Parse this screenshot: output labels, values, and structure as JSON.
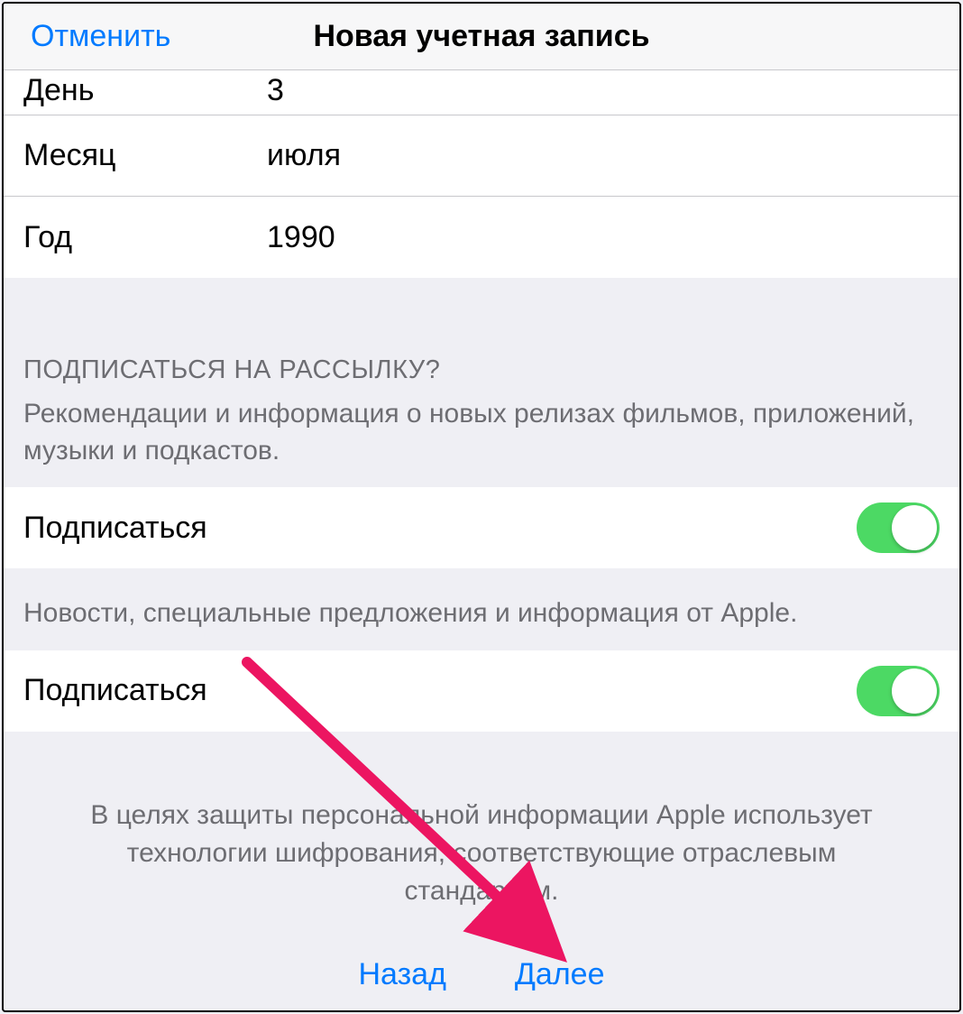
{
  "navbar": {
    "cancel": "Отменить",
    "title": "Новая учетная запись"
  },
  "date_rows": {
    "day_label": "День",
    "day_value": "3",
    "month_label": "Месяц",
    "month_value": "июля",
    "year_label": "Год",
    "year_value": "1990"
  },
  "subscribe_section": {
    "header": "ПОДПИСАТЬСЯ НА РАССЫЛКУ?",
    "desc1": "Рекомендации и информация о новых релизах фильмов, приложений, музыки и подкастов.",
    "toggle1_label": "Подписаться",
    "toggle1_on": true,
    "desc2": "Новости, специальные предложения и информация от Apple.",
    "toggle2_label": "Подписаться",
    "toggle2_on": true
  },
  "footer": {
    "privacy": "В целях защиты персональной информации Apple использует технологии шифрования, соответствующие отраслевым стандартам."
  },
  "bottom_nav": {
    "back": "Назад",
    "next": "Далее"
  },
  "annotation": {
    "arrow_color": "#e91e63"
  }
}
